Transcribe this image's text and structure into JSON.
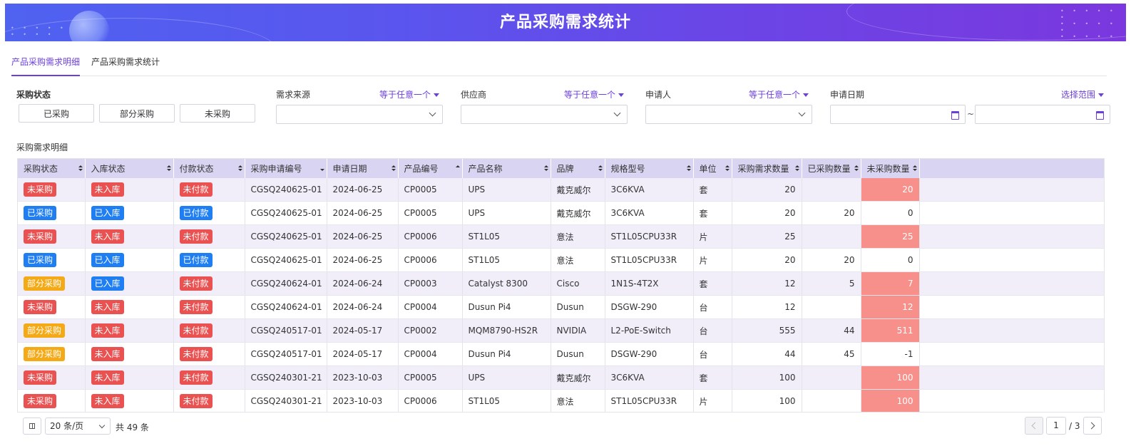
{
  "header": {
    "title": "产品采购需求统计"
  },
  "tabs": [
    {
      "label": "产品采购需求明细",
      "active": true
    },
    {
      "label": "产品采购需求统计",
      "active": false
    }
  ],
  "filters": {
    "status": {
      "label": "采购状态",
      "options": [
        "已采购",
        "部分采购",
        "未采购"
      ]
    },
    "source": {
      "label": "需求来源",
      "mode": "等于任意一个"
    },
    "supplier": {
      "label": "供应商",
      "mode": "等于任意一个"
    },
    "applicant": {
      "label": "申请人",
      "mode": "等于任意一个"
    },
    "date": {
      "label": "申请日期",
      "mode": "选择范围",
      "separator": "~"
    }
  },
  "section_label": "采购需求明细",
  "table": {
    "columns": [
      "采购状态",
      "入库状态",
      "付款状态",
      "采购申请编号",
      "申请日期",
      "产品编号",
      "产品名称",
      "品牌",
      "规格型号",
      "单位",
      "采购需求数量",
      "已采购数量",
      "未采购数量"
    ],
    "rows": [
      [
        "未采购",
        "未入库",
        "未付款",
        "CGSQ240625-01",
        "2024-06-25",
        "CP0005",
        "UPS",
        "戴克威尔",
        "3C6KVA",
        "套",
        "20",
        "",
        "20"
      ],
      [
        "已采购",
        "已入库",
        "已付款",
        "CGSQ240625-01",
        "2024-06-25",
        "CP0005",
        "UPS",
        "戴克威尔",
        "3C6KVA",
        "套",
        "20",
        "20",
        "0"
      ],
      [
        "未采购",
        "未入库",
        "未付款",
        "CGSQ240625-01",
        "2024-06-25",
        "CP0006",
        "ST1L05",
        "意法",
        "ST1L05CPU33R",
        "片",
        "25",
        "",
        "25"
      ],
      [
        "已采购",
        "已入库",
        "已付款",
        "CGSQ240625-01",
        "2024-06-25",
        "CP0006",
        "ST1L05",
        "意法",
        "ST1L05CPU33R",
        "片",
        "20",
        "20",
        "0"
      ],
      [
        "部分采购",
        "已入库",
        "未付款",
        "CGSQ240624-01",
        "2024-06-24",
        "CP0003",
        "Catalyst 8300",
        "Cisco",
        "1N1S-4T2X",
        "套",
        "12",
        "5",
        "7"
      ],
      [
        "未采购",
        "未入库",
        "未付款",
        "CGSQ240624-01",
        "2024-06-24",
        "CP0004",
        "Dusun Pi4",
        "Dusun",
        "DSGW-290",
        "台",
        "12",
        "",
        "12"
      ],
      [
        "部分采购",
        "未入库",
        "未付款",
        "CGSQ240517-01",
        "2024-05-17",
        "CP0002",
        "MQM8790-HS2R",
        "NVIDIA",
        "L2-PoE-Switch",
        "台",
        "555",
        "44",
        "511"
      ],
      [
        "部分采购",
        "未入库",
        "未付款",
        "CGSQ240517-01",
        "2024-05-17",
        "CP0004",
        "Dusun Pi4",
        "Dusun",
        "DSGW-290",
        "台",
        "44",
        "45",
        "-1"
      ],
      [
        "未采购",
        "未入库",
        "未付款",
        "CGSQ240301-21",
        "2023-10-03",
        "CP0005",
        "UPS",
        "戴克威尔",
        "3C6KVA",
        "套",
        "100",
        "",
        "100"
      ],
      [
        "未采购",
        "未入库",
        "未付款",
        "CGSQ240301-21",
        "2023-10-03",
        "CP0006",
        "ST1L05",
        "意法",
        "ST1L05CPU33R",
        "片",
        "100",
        "",
        "100"
      ]
    ]
  },
  "pagination": {
    "page_size": "20 条/页",
    "total": "共 49 条",
    "current_page": "1",
    "total_pages": "/ 3"
  },
  "colors": {
    "accent": "#6b3fdc",
    "header_bg": "#d9d4f2",
    "row_alt": "#f1eefa",
    "highlight": "#f7908a",
    "tag_red": "#ea5151",
    "tag_blue": "#1e7ef2",
    "tag_orange": "#f4a916"
  }
}
